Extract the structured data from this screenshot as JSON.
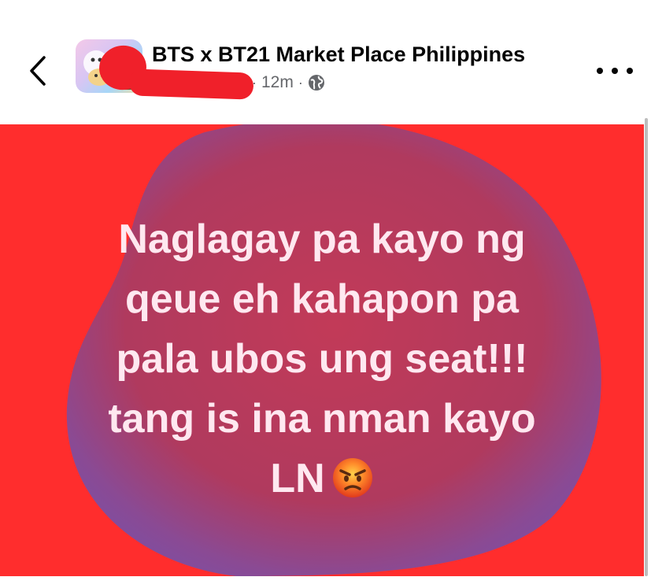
{
  "header": {
    "group_name": "BTS x BT21 Market Place Philippines",
    "time_ago": "12m",
    "separator": "·",
    "privacy_icon": "globe-icon",
    "back_icon": "chevron-left-icon",
    "more_icon": "more-horizontal-icon"
  },
  "post": {
    "lines": [
      "Naglagay pa kayo ng",
      "qeue eh kahapon pa",
      "pala ubos ung seat!!!",
      "tang is ina nman kayo",
      "LN"
    ],
    "emoji": "angry-face-emoji",
    "background_color": "#ff2d2d",
    "blob_color": "#7a4fa6",
    "text_color": "#ffe8f0"
  }
}
